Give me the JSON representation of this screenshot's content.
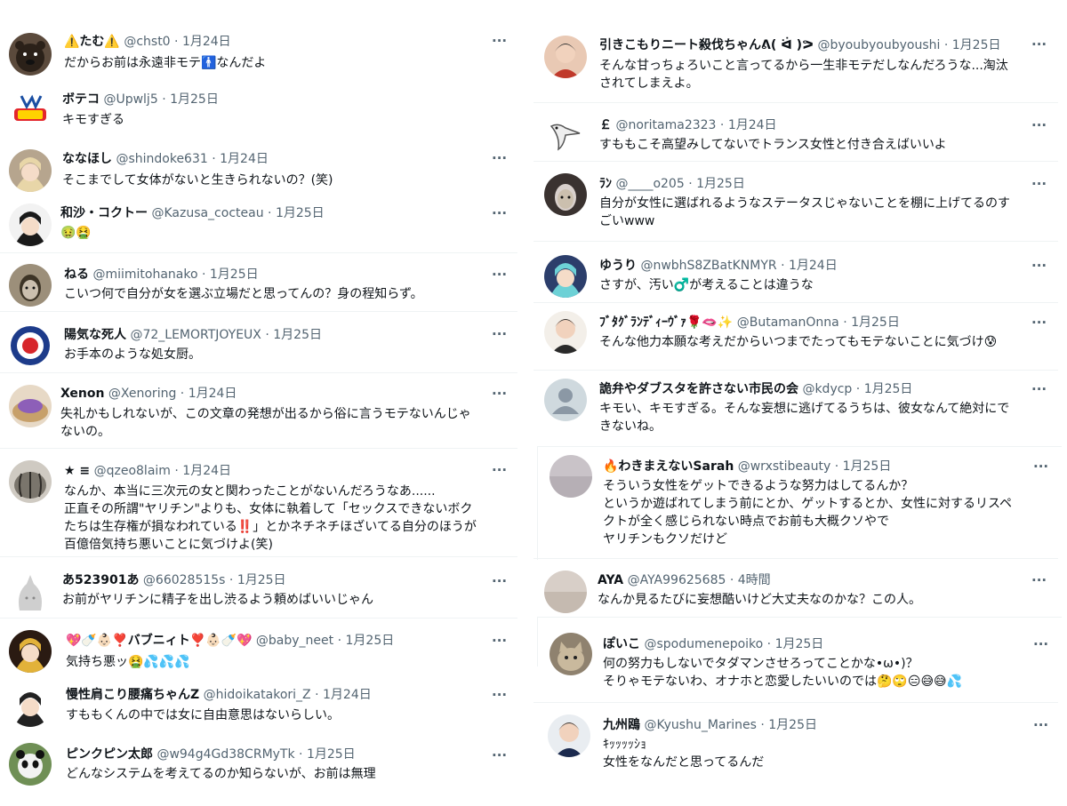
{
  "left": [
    {
      "name": "⚠️たむ⚠️",
      "handle": "@chst0",
      "date": "1月24日",
      "text": "だからお前は永遠非モテ🚹なんだよ",
      "avatar": {
        "bg": "#5b4a3c",
        "fg": "#2b2119",
        "kind": "bear"
      }
    },
    {
      "name": "ボテコ",
      "handle": "@Upwlj5",
      "date": "1月25日",
      "text": "キモすぎる",
      "avatar": {
        "bg": "#ffffff",
        "fg": "#e3262c",
        "kind": "logo"
      }
    },
    {
      "name": "ななほし",
      "handle": "@shindoke631",
      "date": "1月24日",
      "text": "そこまでして女体がないと生きられないの？(笑)",
      "avatar": {
        "bg": "#b6a58e",
        "fg": "#e8d6a8",
        "kind": "anime"
      }
    },
    {
      "name": "和沙・コクトー",
      "handle": "@Kazusa_cocteau",
      "date": "1月25日",
      "text": "🤢🤮",
      "avatar": {
        "bg": "#f2f2f2",
        "fg": "#1a1a1a",
        "kind": "anime"
      }
    },
    {
      "name": "ねる",
      "handle": "@miimitohanako",
      "date": "1月25日",
      "text": "こいつ何で自分が女を選ぶ立場だと思ってんの？身の程知らず。",
      "avatar": {
        "bg": "#9c8f7a",
        "fg": "#3d3426",
        "kind": "face"
      }
    },
    {
      "name": "陽気な死人",
      "handle": "@72_LEMORTJOYEUX",
      "date": "1月25日",
      "text": "お手本のような処女厨。",
      "avatar": {
        "bg": "#ffffff",
        "fg": "#1d3b8a",
        "kind": "roundel"
      }
    },
    {
      "name": "Xenon",
      "handle": "@Xenoring",
      "date": "1月24日",
      "text": "失礼かもしれないが、この文章の発想が出るから俗に言うモテないんじゃ\nないの。",
      "avatar": {
        "bg": "#c7a06a",
        "fg": "#8d5fb8",
        "kind": "food"
      }
    },
    {
      "name": "★ ≡",
      "handle": "@qzeo8laim",
      "date": "1月24日",
      "text": "なんか、本当に三次元の女と関わったことがないんだろうなあ......\n正直その所謂\"ヤリチン\"よりも、女体に執着して「セックスできないボク\nたちは生存権が損なわれている‼️」とかネチネチほざいてる自分のほうが\n百億倍気持ち悪いことに気づけよ(笑)",
      "avatar": {
        "bg": "#7a756c",
        "fg": "#2e2b27",
        "kind": "pumpkin"
      }
    },
    {
      "name": "あ523901あ",
      "handle": "@66028515s",
      "date": "1月25日",
      "text": "お前がヤリチンに精子を出し渋るよう頼めばいいじゃん",
      "avatar": {
        "bg": "#ffffff",
        "fg": "#cfcfcf",
        "kind": "ghost"
      }
    },
    {
      "name": "💖🍼👶🏻❣️バブニィト❣️👶🏻🍼💖",
      "handle": "@baby_neet",
      "date": "1月25日",
      "text": "気持ち悪ッ🤮💦💦💦",
      "avatar": {
        "bg": "#2a1a12",
        "fg": "#e2b23a",
        "kind": "anime"
      }
    },
    {
      "name": "慢性肩こり腰痛ちゃんZ",
      "handle": "@hidoikatakori_Z",
      "date": "1月24日",
      "text": "すももくんの中では女に自由意思はないらしい。",
      "avatar": {
        "bg": "#ffffff",
        "fg": "#222222",
        "kind": "anime"
      }
    },
    {
      "name": "ピンクピン太郎",
      "handle": "@w94g4Gd38CRMyTk",
      "date": "1月25日",
      "text": "どんなシステムを考えてるのか知らないが、お前は無理",
      "avatar": {
        "bg": "#6f8f55",
        "fg": "#f2f2f2",
        "kind": "panda"
      }
    }
  ],
  "right": [
    {
      "name": "引きこもりニート殺伐ちゃんᕕ( ᐛ )ᕗ",
      "handle": "@byoubyoubyoushi",
      "date": "1月25日",
      "text": "そんな甘っちょろいこと言ってるから一生非モテだしなんだろうな...淘汰\nされてしまえよ。",
      "avatar": {
        "bg": "#e9c9b4",
        "fg": "#c0392b",
        "kind": "person"
      }
    },
    {
      "name": "￡",
      "handle": "@noritama2323",
      "date": "1月24日",
      "text": "すももこそ高望みしてないでトランス女性と付き合えばいいよ",
      "avatar": {
        "bg": "#ffffff",
        "fg": "#555555",
        "kind": "bird"
      }
    },
    {
      "name": "ﾗﾝ",
      "handle": "@____o205",
      "date": "1月25日",
      "text": "自分が女性に選ばれるようなステータスじゃないことを棚に上げてるのす\nごいwww",
      "avatar": {
        "bg": "#3a3230",
        "fg": "#d9d0cc",
        "kind": "face"
      }
    },
    {
      "name": "ゆうり",
      "handle": "@nwbhS8ZBatKNMYR",
      "date": "1月24日",
      "text": "さすが、汚い♂️が考えることは違うな",
      "avatar": {
        "bg": "#2c3e6b",
        "fg": "#6dd1d6",
        "kind": "anime"
      }
    },
    {
      "name": "ﾌﾞﾀｸﾞﾗﾝﾃﾞｨｰｳﾞｧ🌹🫦✨",
      "handle": "@ButamanOnna",
      "date": "1月25日",
      "text": "そんな他力本願な考えだからいつまでたってもモテないことに気づけ😰",
      "avatar": {
        "bg": "#f3efe9",
        "fg": "#2a2a2a",
        "kind": "person"
      }
    },
    {
      "name": "詭弁やダブスタを許さない市民の会",
      "handle": "@kdycp",
      "date": "1月25日",
      "text": "キモい、キモすぎる。そんな妄想に逃げてるうちは、彼女なんて絶対にで\nきないね。",
      "avatar": {
        "bg": "#cfd9de",
        "fg": "#8b98a5",
        "kind": "default"
      }
    },
    {
      "name": "🔥わきまえないSarah",
      "handle": "@wrxstibeauty",
      "date": "1月25日",
      "text": "そういう女性をゲットできるような努力はしてるんか？\nというか遊ばれてしまう前にとか、ゲットするとか、女性に対するリスペ\nクトが全く感じられない時点でお前も大概クソやで\nヤリチンもクソだけど",
      "avatar": {
        "bg": "#c9c3c8",
        "fg": "#aaa2a8",
        "kind": "plain"
      }
    },
    {
      "name": "AYA",
      "handle": "@AYA99625685",
      "date": "4時間",
      "text": "なんか見るたびに妄想酷いけど大丈夫なのかな？この人。",
      "avatar": {
        "bg": "#d8cfc8",
        "fg": "#b9aba0",
        "kind": "plain"
      }
    },
    {
      "name": "ぽいこ",
      "handle": "@spodumenepoiko",
      "date": "1月25日",
      "text": "何の努力もしないでタダマンさせろってことかな•ω•)？\nそりゃモテないわ、オナホと恋愛したいいのでは🤔🙄😑😅😅💦",
      "avatar": {
        "bg": "#8f826f",
        "fg": "#c9b99d",
        "kind": "cat"
      }
    },
    {
      "name": "九州鴎",
      "handle": "@Kyushu_Marines",
      "date": "1月25日",
      "text": "ｷｯｯｯｯｼｮ\n女性をなんだと思ってるんだ",
      "avatar": {
        "bg": "#e9edf1",
        "fg": "#1b2a4e",
        "kind": "person"
      }
    }
  ],
  "ui": {
    "more_label": "···",
    "dot": "·"
  }
}
